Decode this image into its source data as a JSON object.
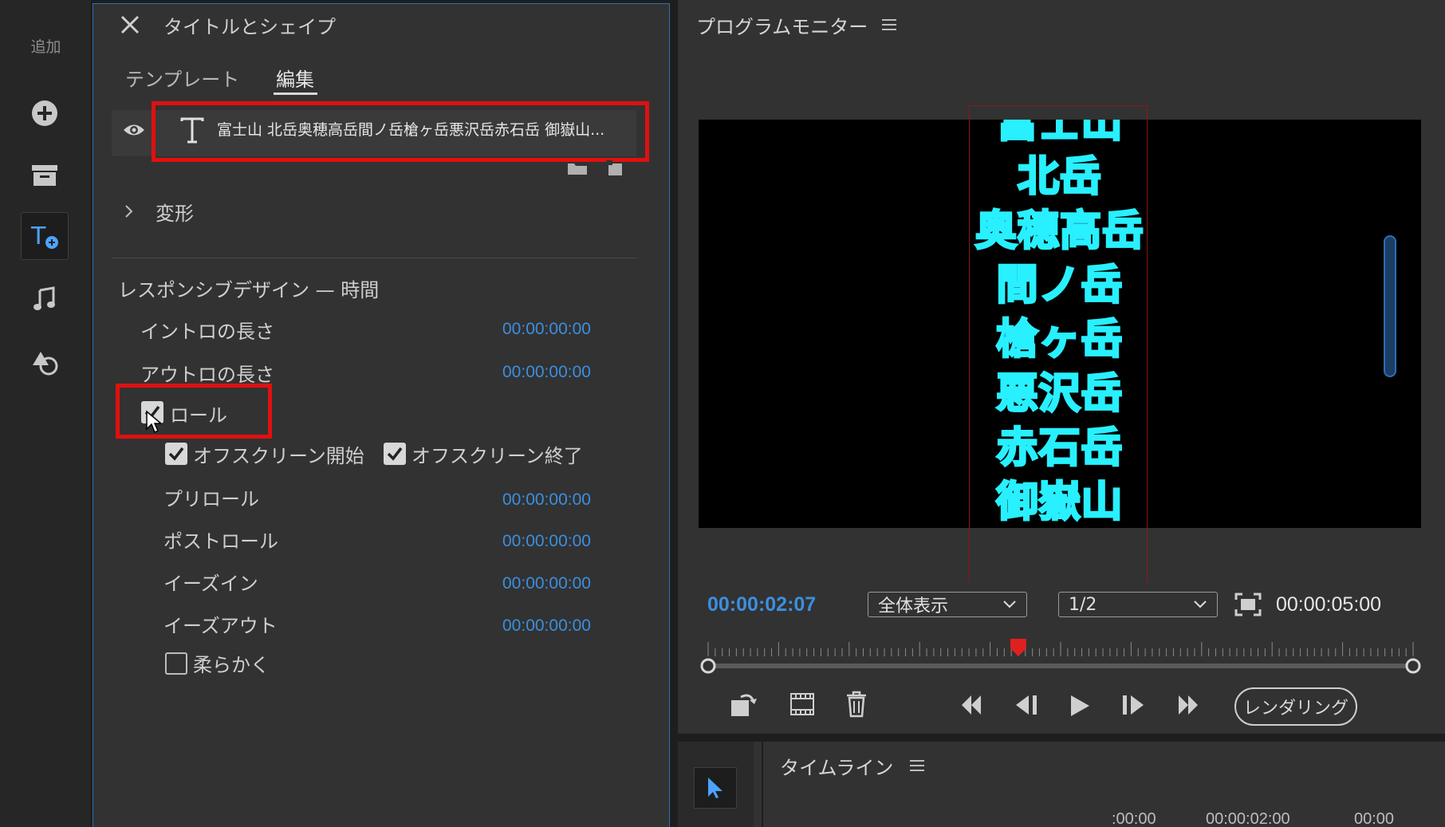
{
  "toolbar": {
    "title": "追加",
    "icons": [
      "add-circle-icon",
      "archive-icon",
      "title-add-icon",
      "music-note-icon",
      "shapes-icon"
    ]
  },
  "panel": {
    "title": "タイトルとシェイプ",
    "tabs": [
      {
        "label": "テンプレート",
        "active": false
      },
      {
        "label": "編集",
        "active": true
      }
    ],
    "layer_text": "富士山 北岳奥穂高岳間ノ岳槍ヶ岳悪沢岳赤石岳 御嶽山...",
    "transform_label": "変形",
    "responsive_header": "レスポンシブデザイン — 時間",
    "intro_label": "イントロの長さ",
    "intro_value": "00:00:00:00",
    "outro_label": "アウトロの長さ",
    "outro_value": "00:00:00:00",
    "roll_label": "ロール",
    "roll_checked": true,
    "offscreen_start_label": "オフスクリーン開始",
    "offscreen_start_checked": true,
    "offscreen_end_label": "オフスクリーン終了",
    "offscreen_end_checked": true,
    "preroll_label": "プリロール",
    "preroll_value": "00:00:00:00",
    "postroll_label": "ポストロール",
    "postroll_value": "00:00:00:00",
    "easein_label": "イーズイン",
    "easein_value": "00:00:00:00",
    "easeout_label": "イーズアウト",
    "easeout_value": "00:00:00:00",
    "smooth_label": "柔らかく",
    "smooth_checked": false
  },
  "monitor": {
    "title": "プログラムモニター",
    "preview_lines": [
      "富士山",
      "北岳",
      "奥穂高岳",
      "間ノ岳",
      "槍ヶ岳",
      "悪沢岳",
      "赤石岳",
      "御嶽山"
    ],
    "current_time": "00:00:02:07",
    "fit_option": "全体表示",
    "resolution_option": "1/2",
    "duration": "00:00:05:00",
    "render_label": "レンダリング",
    "playhead_fraction": 0.44,
    "colors": {
      "timecode": "#3b8fe0",
      "text_fill": "#1a7bff",
      "text_stroke": "#28f0ff",
      "playhead": "#e02020"
    }
  },
  "timeline": {
    "title": "タイムライン",
    "ruler": [
      ":00:00",
      "00:00:02:00",
      "00:00"
    ]
  }
}
